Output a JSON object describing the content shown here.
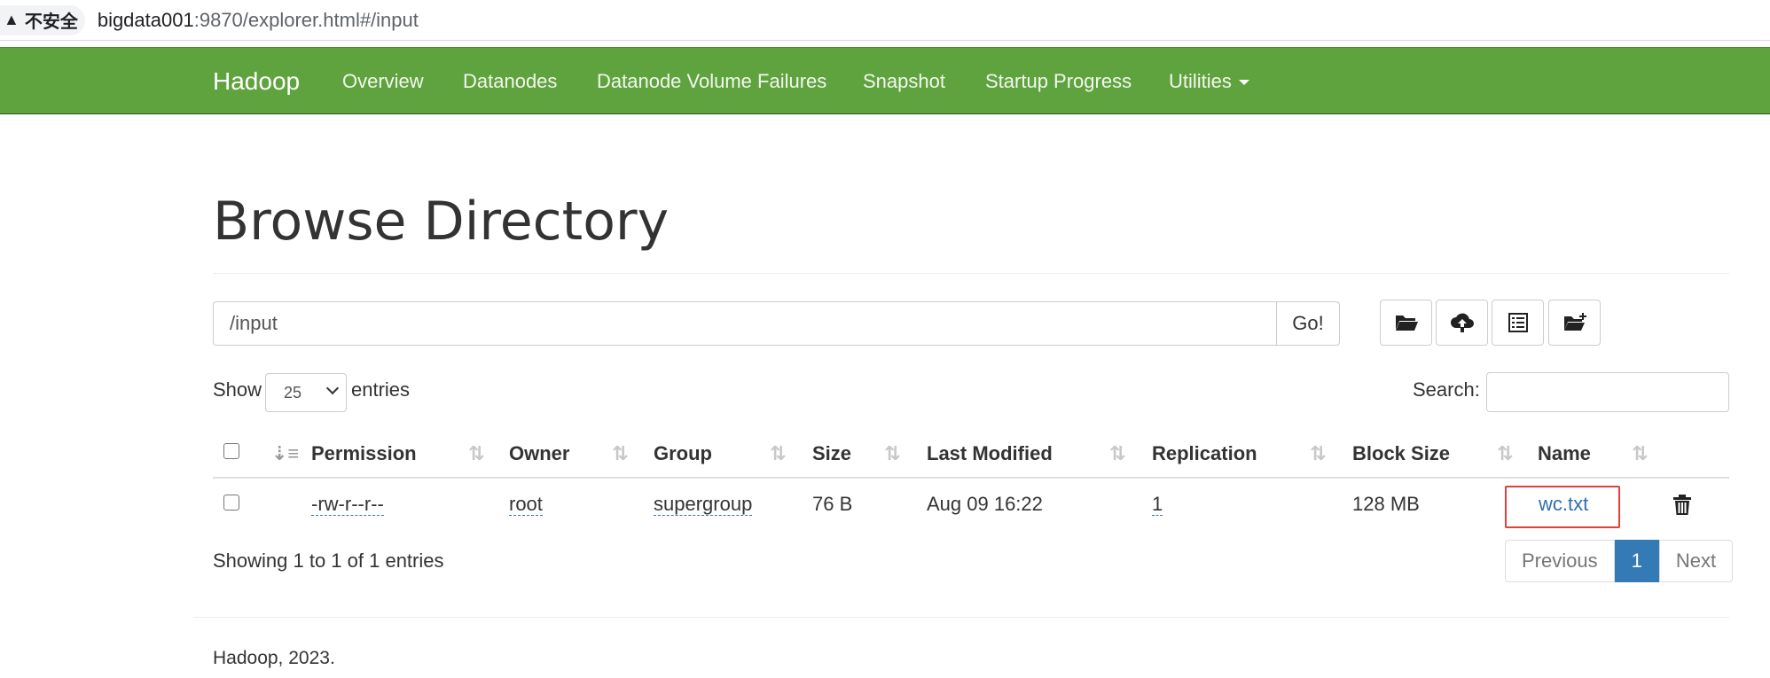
{
  "browser": {
    "security_label": "不安全",
    "url_host": "bigdata001",
    "url_rest": ":9870/explorer.html#/input"
  },
  "navbar": {
    "brand": "Hadoop",
    "items": [
      {
        "label": "Overview"
      },
      {
        "label": "Datanodes"
      },
      {
        "label": "Datanode Volume Failures"
      },
      {
        "label": "Snapshot"
      },
      {
        "label": "Startup Progress"
      },
      {
        "label": "Utilities"
      }
    ],
    "color": "#5fa33e"
  },
  "page": {
    "title": "Browse Directory"
  },
  "path_bar": {
    "value": "/input",
    "go_label": "Go!",
    "tool_icons": [
      "folder-open-icon",
      "cloud-upload-icon",
      "list-icon",
      "new-folder-icon"
    ]
  },
  "table_controls": {
    "show_label": "Show",
    "entries_value": "25",
    "entries_label": "entries",
    "search_label": "Search:"
  },
  "table": {
    "columns": [
      "Permission",
      "Owner",
      "Group",
      "Size",
      "Last Modified",
      "Replication",
      "Block Size",
      "Name"
    ],
    "rows": [
      {
        "permission": "-rw-r--r--",
        "owner": "root",
        "group": "supergroup",
        "size": "76 B",
        "last_modified": "Aug 09 16:22",
        "replication": "1",
        "block_size": "128 MB",
        "name": "wc.txt"
      }
    ]
  },
  "pagination": {
    "info": "Showing 1 to 1 of 1 entries",
    "previous": "Previous",
    "current": "1",
    "next": "Next",
    "active_color": "#337ab7"
  },
  "footer": {
    "text": "Hadoop, 2023."
  }
}
